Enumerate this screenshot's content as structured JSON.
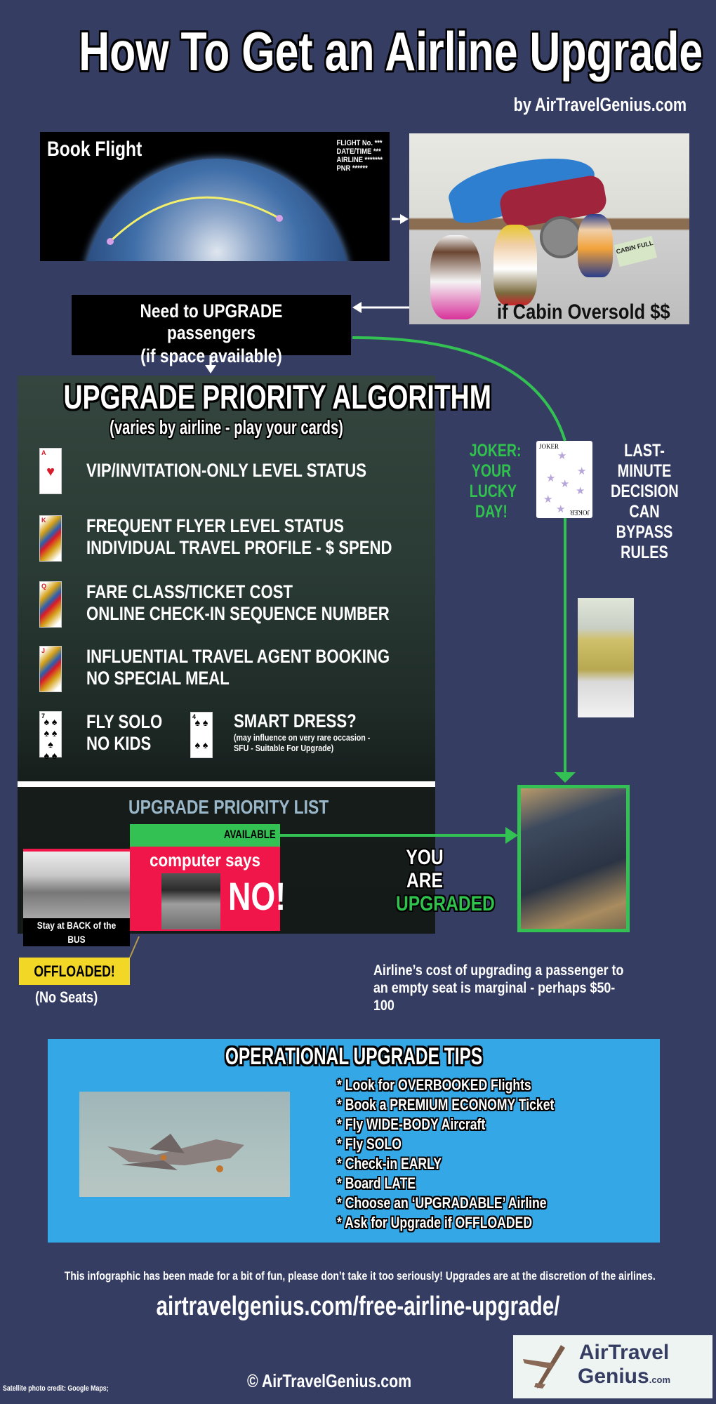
{
  "header": {
    "title": "How To Get an Airline Upgrade",
    "byline": "by AirTravelGenius.com"
  },
  "book_flight": {
    "label": "Book Flight",
    "info_lines": [
      "FLIGHT No. ***",
      "DATE/TIME ***",
      "AIRLINE *******",
      "PNR ******"
    ]
  },
  "toy_photo": {
    "sign_text": "CABIN FULL",
    "caption": "if Cabin Oversold $$"
  },
  "need_upgrade": {
    "line1": "Need to UPGRADE passengers",
    "line2": "(if space available)"
  },
  "algorithm": {
    "title": "UPGRADE PRIORITY ALGORITHM",
    "subtitle": "(varies by airline - play your cards)",
    "criteria": [
      {
        "card": "A",
        "suit": "♥",
        "lines": [
          "VIP/INVITATION-ONLY LEVEL STATUS"
        ]
      },
      {
        "card": "K",
        "suit": "♥",
        "lines": [
          "FREQUENT FLYER LEVEL STATUS",
          "INDIVIDUAL TRAVEL PROFILE - $ SPEND"
        ]
      },
      {
        "card": "Q",
        "suit": "♥",
        "lines": [
          "FARE CLASS/TICKET COST",
          "ONLINE CHECK-IN SEQUENCE NUMBER"
        ]
      },
      {
        "card": "J",
        "suit": "♥",
        "lines": [
          "INFLUENTIAL TRAVEL AGENT BOOKING",
          "NO SPECIAL MEAL"
        ]
      },
      {
        "card": "7",
        "suit": "♠",
        "lines": [
          "FLY SOLO",
          "NO KIDS"
        ]
      },
      {
        "card": "4",
        "suit": "♠",
        "lines": [
          "SMART DRESS?"
        ],
        "note": [
          "(may influence on very rare occasion -",
          "SFU - Suitable For Upgrade)"
        ]
      }
    ]
  },
  "priority_list": {
    "title": "UPGRADE PRIORITY LIST",
    "available": "AVAILABLE",
    "computer_says": "computer says",
    "no": "NO!",
    "bus_caption": "Stay at BACK of the BUS"
  },
  "joker": {
    "left_lines": [
      "JOKER:",
      "YOUR",
      "LUCKY",
      "DAY!"
    ],
    "card_label": "JOKER",
    "right_lines": [
      "LAST-MINUTE",
      "DECISION",
      "CAN BYPASS",
      "RULES"
    ]
  },
  "upgraded": {
    "line1": "YOU",
    "line2": "ARE",
    "line3": "UPGRADED"
  },
  "offloaded": {
    "label": "OFFLOADED!",
    "sub": "(No Seats)"
  },
  "cost_note": "Airline’s cost of upgrading a passenger to an empty seat is marginal - perhaps $50-100",
  "tips": {
    "title": "OPERATIONAL UPGRADE TIPS",
    "items": [
      "* Look for OVERBOOKED Flights",
      "* Book a PREMIUM ECONOMY Ticket",
      "* Fly WIDE-BODY Aircraft",
      "* Fly SOLO",
      "* Check-in EARLY",
      "* Board LATE",
      "* Choose an ‘UPGRADABLE’ Airline",
      "* Ask for Upgrade if OFFLOADED"
    ]
  },
  "footer": {
    "disclaimer": "This infographic has been made for a bit of fun, please don’t take it too seriously! Upgrades are at the discretion of the airlines.",
    "url": "airtravelgenius.com/free-airline-upgrade/",
    "photo_credit": "Satellite photo credit: Google Maps;",
    "copyright": "© AirTravelGenius.com",
    "logo_line1": "AirTravel",
    "logo_line2": "Genius",
    "logo_suffix": ".com"
  },
  "colors": {
    "background": "#363d63",
    "accent_green": "#34c153",
    "alert_red": "#f0164a",
    "offload_yellow": "#f2d727",
    "tips_blue": "#34a8e6"
  }
}
